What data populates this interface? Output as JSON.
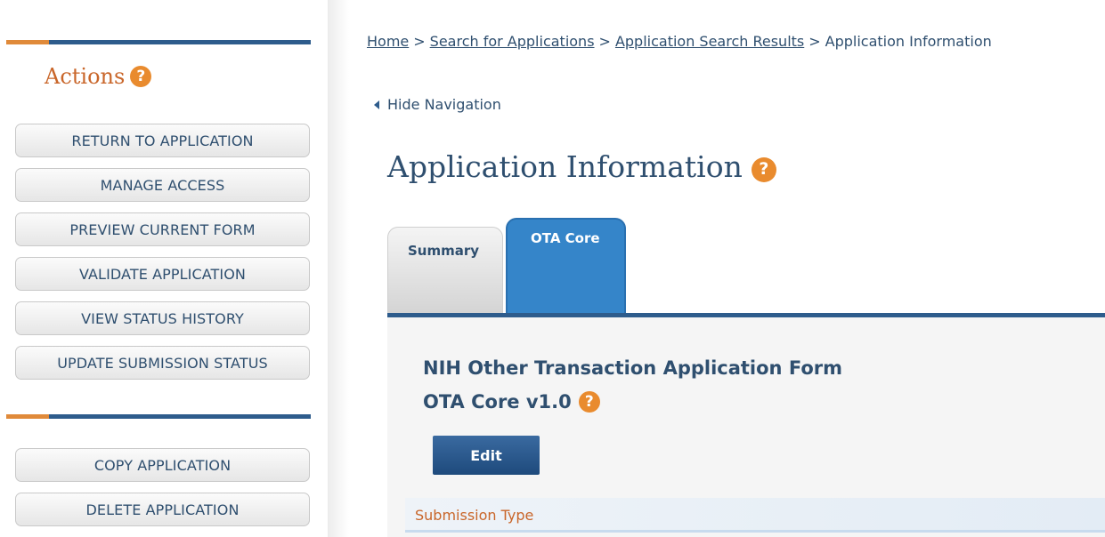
{
  "sidebar": {
    "title": "Actions",
    "help_icon": "?",
    "buttons": [
      {
        "label": "RETURN TO APPLICATION"
      },
      {
        "label": "MANAGE ACCESS"
      },
      {
        "label": "PREVIEW CURRENT FORM"
      },
      {
        "label": "VALIDATE APPLICATION"
      },
      {
        "label": "VIEW STATUS HISTORY"
      },
      {
        "label": "UPDATE SUBMISSION STATUS"
      }
    ],
    "buttons_secondary": [
      {
        "label": "COPY APPLICATION"
      },
      {
        "label": "DELETE APPLICATION"
      }
    ]
  },
  "breadcrumb": {
    "items": [
      "Home",
      "Search for Applications",
      "Application Search Results"
    ],
    "current": "Application Information",
    "separator": ">"
  },
  "hide_navigation": {
    "label": "Hide Navigation"
  },
  "page": {
    "title": "Application Information",
    "help_icon": "?"
  },
  "tabs": [
    {
      "label": "Summary",
      "active": false
    },
    {
      "label": "OTA Core",
      "active": true
    }
  ],
  "form": {
    "title_line1": "NIH Other Transaction Application Form",
    "title_line2": "OTA Core v1.0",
    "help_icon": "?",
    "edit_label": "Edit",
    "section_label": "Submission Type"
  },
  "colors": {
    "accent_orange": "#e98b2e",
    "navy": "#2e5c8c",
    "tab_active": "#3585c9",
    "text": "#2f4f6f"
  }
}
